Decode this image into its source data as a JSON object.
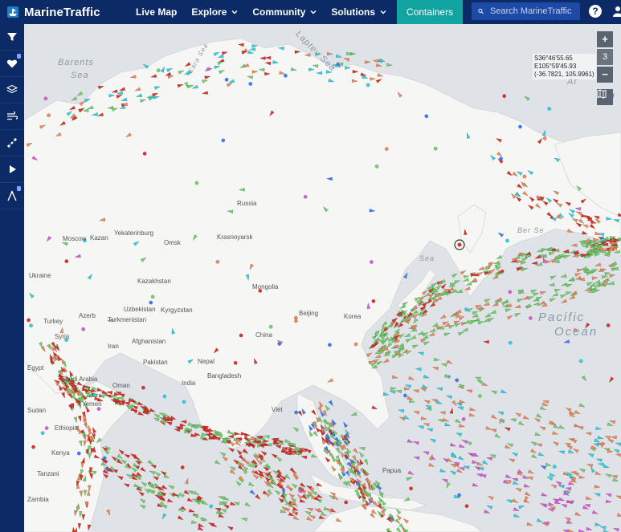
{
  "app": {
    "name": "MarineTraffic"
  },
  "nav": {
    "live_map": "Live Map",
    "explore": "Explore",
    "community": "Community",
    "solutions": "Solutions",
    "containers": "Containers"
  },
  "search": {
    "placeholder": "Search MarineTraffic"
  },
  "help": {
    "label": "?"
  },
  "sidebar": {
    "items": [
      {
        "icon": "filter-icon"
      },
      {
        "icon": "heart-icon"
      },
      {
        "icon": "layers-icon"
      },
      {
        "icon": "wind-icon"
      },
      {
        "icon": "route-icon"
      },
      {
        "icon": "play-icon"
      },
      {
        "icon": "measure-icon"
      }
    ]
  },
  "map": {
    "zoom_in": "+",
    "zoom_level": "3",
    "zoom_out": "−",
    "coords": {
      "lat": "S36°46'55.65",
      "lon": "E105°59'45.93",
      "decimal": "(-36.7821, 105.9961)"
    },
    "labels": {
      "barents": "Barents",
      "barents2": "Sea",
      "kara": "Kara Sea",
      "laptev": "Laptev Sea",
      "russia": "Russia",
      "moscow": "Moscow",
      "kazan": "Kazan",
      "yekaterinburg": "Yekaterinburg",
      "omsk": "Omsk",
      "krasnoyarsk": "Krasnoyarsk",
      "ukraine": "Ukraine",
      "kazakhstan": "Kazakhstan",
      "mongolia": "Mongolia",
      "uzbekistan": "Uzbekistan",
      "kyrgyzstan": "Kyrgyzstan",
      "turkmenistan": "Turkmenistan",
      "turkey": "Turkey",
      "azerbaijan": "Azerb",
      "syria": "Syria",
      "iran": "Iran",
      "afghanistan": "Afghanistan",
      "pakistan": "Pakistan",
      "nepal": "Nepal",
      "bangladesh": "Bangladesh",
      "india": "India",
      "china": "China",
      "beijing": "Beijing",
      "korea": "Korea",
      "egypt": "Egypt",
      "saudi": "Saudi Arabia",
      "oman": "Oman",
      "yemen": "Yemen",
      "sudan": "Sudan",
      "ethiopia": "Ethiopia",
      "kenya": "Kenya",
      "tanzania": "Tanzani",
      "zambia": "Zambia",
      "viet": "Viet",
      "papua": "Papua",
      "pacific": "Pacific",
      "ocean": "Ocean",
      "okhotsk": "Sea",
      "bering": "Ber Se",
      "arctic": "Ar"
    }
  },
  "colors": {
    "header": "#0b2a66",
    "containers": "#12a4a0",
    "cargo": "#6fd36a",
    "tanker": "#e0302a",
    "other": "#f08a5d",
    "passenger": "#3a7bff",
    "fishing": "#2ad3e6",
    "pleasure": "#e05adc",
    "land": "#f6f6f4",
    "water": "#dfe2e6"
  }
}
